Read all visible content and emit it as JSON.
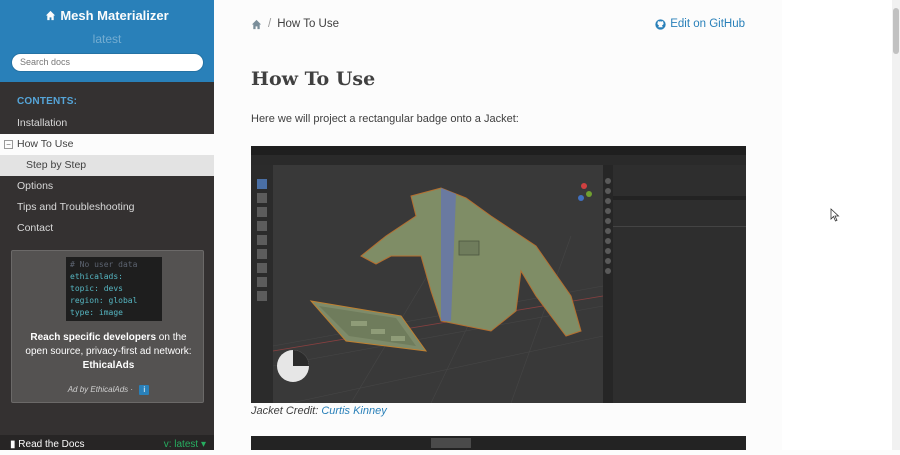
{
  "sidebar": {
    "project_title": "Mesh Materializer",
    "version": "latest",
    "search_placeholder": "Search docs",
    "caption": "CONTENTS:",
    "items": [
      {
        "label": "Installation"
      },
      {
        "label": "How To Use"
      },
      {
        "label": "Step by Step"
      },
      {
        "label": "Options"
      },
      {
        "label": "Tips and Troubleshooting"
      },
      {
        "label": "Contact"
      }
    ],
    "current_toggle": "−"
  },
  "ad": {
    "code_lines": [
      "# No user data",
      "ethicalads:",
      "  topic: devs",
      "  region: global",
      "  type: image"
    ],
    "text_bold": "Reach specific developers",
    "text_rest": " on the open source, privacy-first ad network: ",
    "text_network": "EthicalAds",
    "by_line": "Ad by EthicalAds",
    "dot": "·",
    "info": "i"
  },
  "rtd": {
    "label": "Read the Docs",
    "version": "v: latest"
  },
  "content": {
    "breadcrumb_current": "How To Use",
    "edit_label": "Edit on GitHub",
    "title": "How To Use",
    "intro": "Here we will project a rectangular badge onto a Jacket:",
    "caption_prefix": "Jacket Credit: ",
    "caption_link": "Curtis Kinney"
  },
  "colors": {
    "brand": "#2980b9",
    "sidebar_bg": "#343131",
    "link": "#2980b9"
  }
}
